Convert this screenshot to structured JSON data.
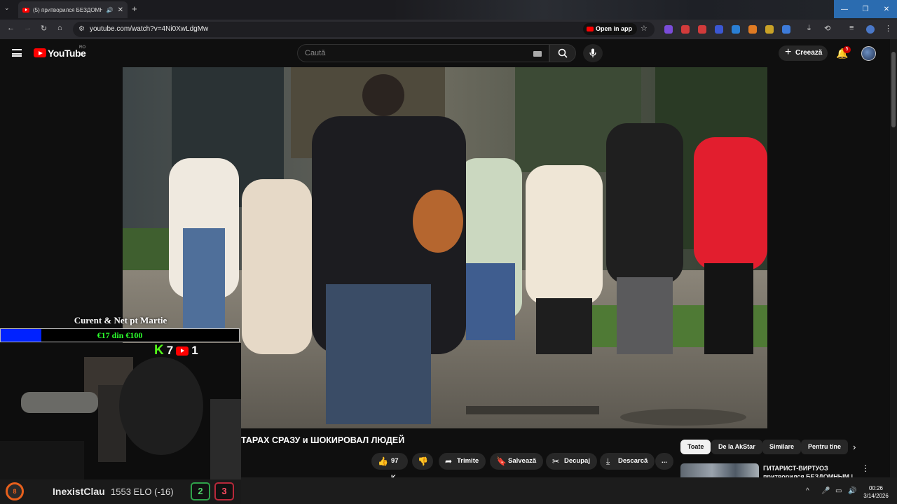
{
  "browser": {
    "tab_title": "(5) притворился БЕЗДОМН",
    "tab_audio_icon": "speaker-icon",
    "new_tab": "+",
    "url": "youtube.com/watch?v=4Ni0XwLdgMw",
    "open_in_app": "Open in app"
  },
  "youtube": {
    "logo_text": "YouTube",
    "country_code": "RO",
    "search_placeholder": "Caută",
    "create_label": "Creează",
    "notification_count": "5"
  },
  "video": {
    "title": "ТАРАХ СРАЗУ и ШОКИРОВАЛ ЛЮДЕЙ",
    "like_count": "97 K",
    "share_label": "Trimite",
    "save_label": "Salvează",
    "clip_label": "Decupaj",
    "download_label": "Descarcă",
    "more_label": "..."
  },
  "recommendations": {
    "chips": [
      "Toate",
      "De la AkStar",
      "Similare",
      "Pentru tine"
    ],
    "first_title": "ГИТАРИСТ-ВИРТУОЗ притворился БЕЗДОМНЫМ | ..."
  },
  "overlay": {
    "goal_title": "Curent & Net pt Martie",
    "goal_text": "€17 din €100",
    "goal_progress": 0.17,
    "kick_count": "7",
    "youtube_count": "1",
    "kick_logo": "K",
    "elo_logo_level": "8",
    "username": "InexistClau",
    "elo_text": "1553 ELO (-16)",
    "wins": "2",
    "losses": "3"
  },
  "system": {
    "time": "00:26",
    "date": "3/14/2026",
    "tray_arrow": "^"
  },
  "colors": {
    "youtube_red": "#ff0000",
    "kick_green": "#53fc18",
    "goal_blue": "#0022ff",
    "goal_text_green": "#2cff2c",
    "win_green": "#2fa24a",
    "loss_red": "#b8283a",
    "faceit_orange": "#e8601c"
  }
}
